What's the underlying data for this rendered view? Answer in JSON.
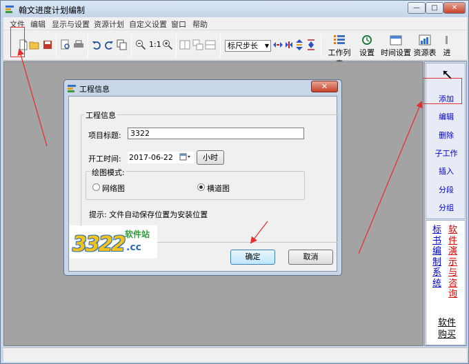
{
  "window": {
    "title": "翰文进度计划编制",
    "controls": {
      "minimize": "—",
      "maximize": "□",
      "close": "✕"
    }
  },
  "menubar": {
    "items": [
      "文件",
      "编辑",
      "显示与设置",
      "资源计划",
      "自定义设置",
      "窗口",
      "帮助"
    ]
  },
  "toolbar": {
    "zoom_label": "1:1",
    "ruler_select": "标尺步长",
    "big_buttons": [
      "工作列表",
      "设置",
      "时间设置",
      "资源表",
      "进"
    ]
  },
  "right_panel": {
    "items": [
      "添加",
      "编辑",
      "删除",
      "子工作",
      "插入",
      "分段",
      "分组"
    ],
    "link_left": "标书编制系统",
    "link_right": "软件演示与咨询",
    "buy_link": "软件购买"
  },
  "dialog": {
    "title": "工程信息",
    "close": "✕",
    "section_title": "工程信息",
    "project_title_label": "项目标题:",
    "project_title_value": "3322",
    "start_time_label": "开工时间:",
    "start_date": "2017-06-22",
    "hour_button": "小时",
    "drawing_mode_label": "绘图模式:",
    "mode_network": "网络图",
    "mode_bar": "横道图",
    "hint": "提示: 文件自动保存位置为安装位置",
    "ok_button": "确定",
    "cancel_button": "取消"
  },
  "watermark": {
    "number": "3322",
    "domain_suffix": ".cc",
    "site_label": "软件站"
  },
  "colors": {
    "annotation_red": "#e53030",
    "link_blue": "#0000cc",
    "link_red": "#e00000"
  }
}
